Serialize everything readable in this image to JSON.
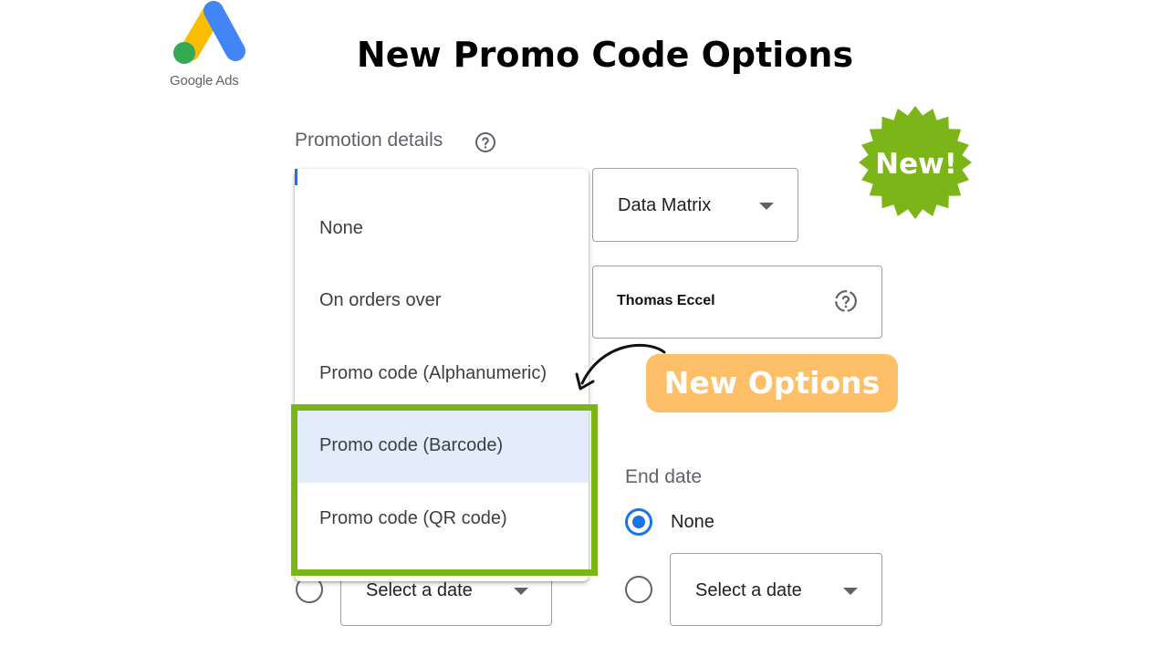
{
  "logo": {
    "text": "Google Ads",
    "colors": [
      "#fbbc04",
      "#4285f4",
      "#34a853"
    ]
  },
  "headline": "New Promo Code Options",
  "promotion_details": {
    "label": "Promotion details",
    "format_select": {
      "value": "Data Matrix"
    },
    "name_field": {
      "value": "Thomas Eccel"
    }
  },
  "dropdown": {
    "options": [
      {
        "label": "None",
        "selected": false
      },
      {
        "label": "On orders over",
        "selected": false
      },
      {
        "label": "Promo code (Alphanumeric)",
        "selected": false
      },
      {
        "label": "Promo code (Barcode)",
        "selected": true
      },
      {
        "label": "Promo code (QR code)",
        "selected": false
      }
    ]
  },
  "callouts": {
    "new_options": "New Options",
    "new_badge": "New!",
    "highlight_color": "#7cb518",
    "badge_color": "#fdbf68"
  },
  "start_date": {
    "select_placeholder": "Select a date"
  },
  "end_date": {
    "label": "End date",
    "none_label": "None",
    "select_placeholder": "Select a date"
  },
  "accent_color": "#1a73e8"
}
